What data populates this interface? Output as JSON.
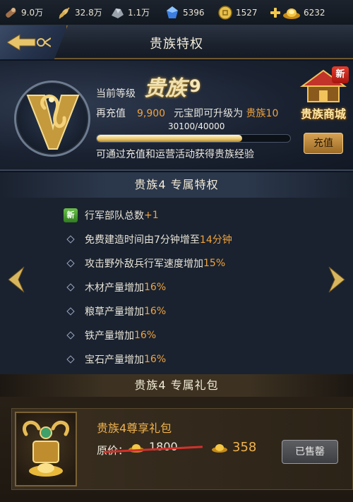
{
  "resources": {
    "wood": {
      "icon": "wood-log-icon",
      "value": "9.0万"
    },
    "food": {
      "icon": "grain-icon",
      "value": "32.8万"
    },
    "iron": {
      "icon": "iron-ore-icon",
      "value": "1.1万"
    },
    "gem": {
      "icon": "blue-gem-icon",
      "value": "5396"
    },
    "silver": {
      "icon": "coin-icon",
      "value": "1527"
    },
    "gold": {
      "icon": "gold-ingot-icon",
      "value": "6232"
    }
  },
  "header": {
    "title": "贵族特权"
  },
  "vip": {
    "current_label": "当前等级",
    "level_name": "贵族",
    "level_num": "9",
    "recharge_prefix": "再充值",
    "recharge_amount": "9,900",
    "recharge_suffix": "元宝即可升级为",
    "next_level": "贵族10",
    "progress_text": "30100/40000",
    "progress_value": 0.7525,
    "exp_hint": "可通过充值和运营活动获得贵族经验",
    "recharge_button": "充值",
    "shop_label": "贵族商城",
    "shop_new": "新"
  },
  "privileges": {
    "title": "贵族4  专属特权",
    "new_tag": "新",
    "items": [
      {
        "text": "行军部队总数",
        "highlight": "+1"
      },
      {
        "text": "免费建造时间由7分钟增至",
        "highlight": "14分钟"
      },
      {
        "text": "攻击野外敌兵行军速度增加",
        "highlight": "15%"
      },
      {
        "text": "木材产量增加",
        "highlight": "16%"
      },
      {
        "text": "粮草产量增加",
        "highlight": "16%"
      },
      {
        "text": "铁产量增加",
        "highlight": "16%"
      },
      {
        "text": "宝石产量增加",
        "highlight": "16%"
      }
    ]
  },
  "gift": {
    "title": "贵族4  专属礼包",
    "name": "贵族4尊享礼包",
    "orig_label": "原价：",
    "orig_price": "1800",
    "price": "358",
    "sold_label": "已售罄"
  },
  "colors": {
    "accent": "#f3a33b",
    "gold": "#f1b34d",
    "bg": "#0d1421"
  }
}
